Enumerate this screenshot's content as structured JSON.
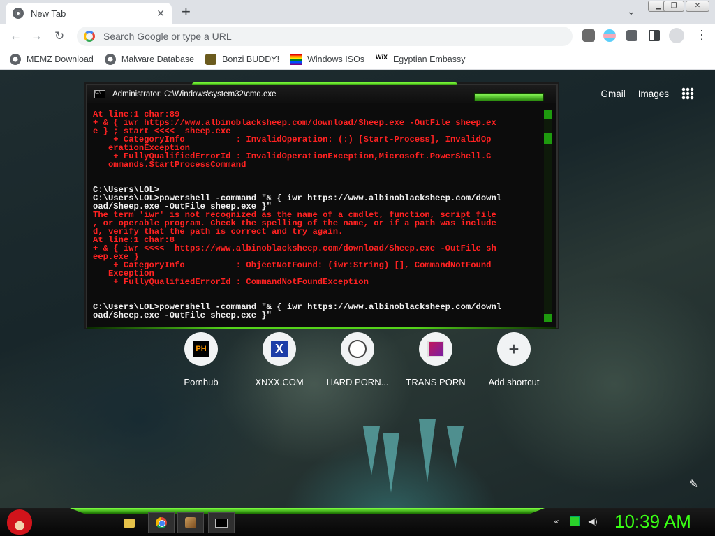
{
  "browser": {
    "tab_title": "New Tab",
    "tab_close": "✕",
    "new_tab": "+",
    "tab_search": "⌄",
    "omnibox_placeholder": "Search Google or type a URL",
    "window_controls": {
      "min": "▁",
      "max": "❐",
      "close": "✕"
    },
    "nav": {
      "back": "←",
      "forward": "→",
      "reload": "↻",
      "menu": "⋮"
    }
  },
  "bookmarks": [
    {
      "label": "MEMZ Download",
      "icon": "globe-icon"
    },
    {
      "label": "Malware Database",
      "icon": "globe-icon"
    },
    {
      "label": "Bonzi BUDDY!",
      "icon": "bonzi-icon"
    },
    {
      "label": "Windows ISOs",
      "icon": "rainbow-flag-icon"
    },
    {
      "label": "Egyptian Embassy",
      "icon": "wix-icon",
      "icon_text": "WiX"
    }
  ],
  "newtab": {
    "gmail": "Gmail",
    "images": "Images",
    "shortcuts": [
      {
        "label": "Pornhub",
        "icon_text": "PH"
      },
      {
        "label": "XNXX.COM",
        "icon_text": "X"
      },
      {
        "label": "HARD PORN...",
        "icon_text": ""
      },
      {
        "label": "TRANS PORN",
        "icon_text": ""
      },
      {
        "label": "Add shortcut",
        "icon_text": "+"
      }
    ],
    "edit": "✎"
  },
  "cmd": {
    "title": "Administrator: C:\\Windows\\system32\\cmd.exe",
    "icon_text": "C:\\",
    "lines": [
      {
        "c": "red",
        "t": "At line:1 char:89"
      },
      {
        "c": "red",
        "t": "+ & { iwr https://www.albinoblacksheep.com/download/Sheep.exe -OutFile sheep.ex"
      },
      {
        "c": "red",
        "t": "e } ; start <<<<  sheep.exe"
      },
      {
        "c": "red",
        "t": "    + CategoryInfo          : InvalidOperation: (:) [Start-Process], InvalidOp"
      },
      {
        "c": "red",
        "t": "   erationException"
      },
      {
        "c": "red",
        "t": "    + FullyQualifiedErrorId : InvalidOperationException,Microsoft.PowerShell.C"
      },
      {
        "c": "red",
        "t": "   ommands.StartProcessCommand"
      },
      {
        "c": "white",
        "t": ""
      },
      {
        "c": "white",
        "t": ""
      },
      {
        "c": "white",
        "t": "C:\\Users\\LOL>"
      },
      {
        "c": "white",
        "t": "C:\\Users\\LOL>powershell -command \"& { iwr https://www.albinoblacksheep.com/downl"
      },
      {
        "c": "white",
        "t": "oad/Sheep.exe -OutFile sheep.exe }\""
      },
      {
        "c": "red",
        "t": "The term 'iwr' is not recognized as the name of a cmdlet, function, script file"
      },
      {
        "c": "red",
        "t": ", or operable program. Check the spelling of the name, or if a path was include"
      },
      {
        "c": "red",
        "t": "d, verify that the path is correct and try again."
      },
      {
        "c": "red",
        "t": "At line:1 char:8"
      },
      {
        "c": "red",
        "t": "+ & { iwr <<<<  https://www.albinoblacksheep.com/download/Sheep.exe -OutFile sh"
      },
      {
        "c": "red",
        "t": "eep.exe }"
      },
      {
        "c": "red",
        "t": "    + CategoryInfo          : ObjectNotFound: (iwr:String) [], CommandNotFound"
      },
      {
        "c": "red",
        "t": "   Exception"
      },
      {
        "c": "red",
        "t": "    + FullyQualifiedErrorId : CommandNotFoundException"
      },
      {
        "c": "white",
        "t": ""
      },
      {
        "c": "white",
        "t": ""
      },
      {
        "c": "white",
        "t": "C:\\Users\\LOL>powershell -command \"& { iwr https://www.albinoblacksheep.com/downl"
      },
      {
        "c": "white",
        "t": "oad/Sheep.exe -OutFile sheep.exe }\""
      }
    ]
  },
  "taskbar": {
    "clock": "10:39 AM",
    "items": [
      "folder-icon",
      "chrome-icon",
      "paint-icon",
      "cmd-icon"
    ],
    "tray": [
      "keyboard-icon",
      "network-icon",
      "volume-icon"
    ]
  },
  "colors": {
    "cmd_red": "#ff2222",
    "accent_green": "#39ff14"
  }
}
